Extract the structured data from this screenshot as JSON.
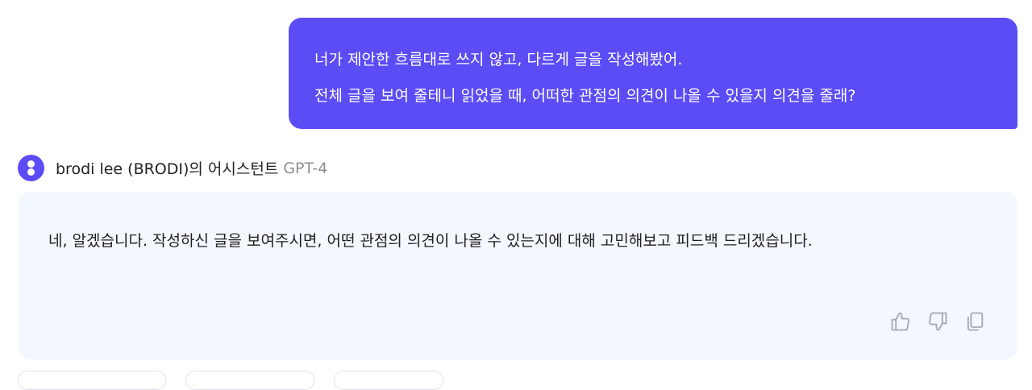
{
  "user_message": {
    "lines": [
      "너가 제안한 흐름대로 쓰지 않고, 다르게 글을 작성해봤어.",
      "전체 글을 보여 줄테니 읽었을 때, 어떠한 관점의 의견이 나올 수 있을지 의견을 줄래?"
    ]
  },
  "bot": {
    "name": "brodi lee (BRODI)의 어시스턴트",
    "model": "GPT-4",
    "message": "네, 알겠습니다. 작성하신 글을 보여주시면, 어떤 관점의 의견이 나올 수 있는지에 대해 고민해보고 피드백 드리겠습니다.",
    "actions": [
      {
        "icon": "thumbs-up-icon"
      },
      {
        "icon": "thumbs-down-icon"
      },
      {
        "icon": "copy-icon"
      }
    ]
  },
  "colors": {
    "accent": "#5b4cf5",
    "bot_bubble_bg": "#f3f7fe",
    "model_text": "#8d8d95",
    "icon_gray": "#a4a9b4"
  }
}
